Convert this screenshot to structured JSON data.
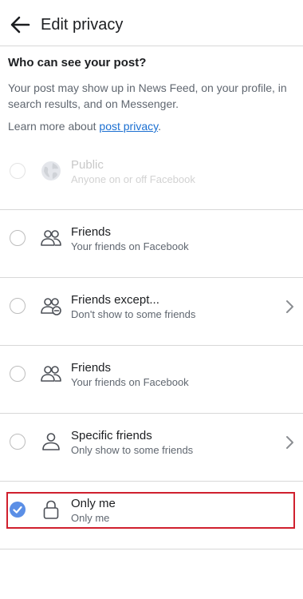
{
  "header": {
    "title": "Edit privacy",
    "back_icon": "arrow-left-icon"
  },
  "intro": {
    "heading": "Who can see your post?",
    "description": "Your post may show up in News Feed, on your profile, in search results, and on Messenger.",
    "learn_prefix": "Learn more about ",
    "learn_link": "post privacy",
    "learn_suffix": "."
  },
  "options": [
    {
      "title": "Public",
      "subtitle": "Anyone on or off Facebook",
      "icon": "globe-icon",
      "selected": false,
      "disabled": true,
      "has_chevron": false
    },
    {
      "title": "Friends",
      "subtitle": "Your friends on Facebook",
      "icon": "friends-icon",
      "selected": false,
      "disabled": false,
      "has_chevron": false
    },
    {
      "title": "Friends except...",
      "subtitle": "Don't show to some friends",
      "icon": "friends-except-icon",
      "selected": false,
      "disabled": false,
      "has_chevron": true
    },
    {
      "title": "Friends",
      "subtitle": "Your friends on Facebook",
      "icon": "friends-icon",
      "selected": false,
      "disabled": false,
      "has_chevron": false
    },
    {
      "title": "Specific friends",
      "subtitle": "Only show to some friends",
      "icon": "person-icon",
      "selected": false,
      "disabled": false,
      "has_chevron": true
    },
    {
      "title": "Only me",
      "subtitle": "Only me",
      "icon": "lock-icon",
      "selected": true,
      "disabled": false,
      "has_chevron": false
    }
  ],
  "colors": {
    "accent": "#5b8fe6",
    "link": "#1b6fd1",
    "highlight_border": "#d0202e"
  }
}
